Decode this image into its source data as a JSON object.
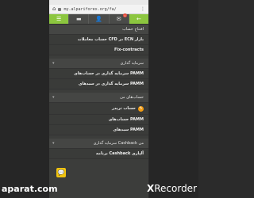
{
  "browser": {
    "url": "my.alpariforex.org/fa/",
    "home_glyph": "⌂",
    "menu_glyph": "⋮"
  },
  "navbar": {
    "menu_glyph": "☰",
    "card_glyph": "▬",
    "user_glyph": "👤",
    "mail_glyph": "✉",
    "mail_badge": "1",
    "back_glyph": "←"
  },
  "menu": {
    "open_account": "افتتاح حساب",
    "cfd_account": "حساب معاملات CFD در ECN بازار",
    "fix_contracts": "Fix-contracts",
    "investment": "سرمایه گذاری",
    "pamm_accounts_invest": "سرمایه گذاری در حساب‌های PAMM",
    "pamm_portfolio_invest": "سرمایه گذاری در سبدهای PAMM",
    "my_accounts": "حساب‌های من",
    "trader_account": "حساب تریدر",
    "pamm_account": "حساب‌های PAMM",
    "pamm_portfolios": "سبدهای PAMM",
    "cashback": "سرمایه گذاری Cashback من",
    "cashback_program": "برنامه Cashback آلپاری"
  },
  "watermarks": {
    "left": "aparat.com",
    "right_prefix": "X",
    "right_suffix": "Recorder"
  },
  "colors": {
    "accent": "#8cc63f",
    "chat": "#f1c40f",
    "edit": "#f39c12"
  }
}
